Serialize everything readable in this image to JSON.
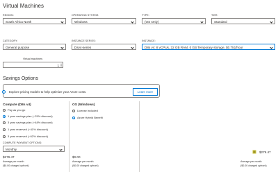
{
  "title": "Virtual Machines",
  "region": {
    "label": "REGION:",
    "value": "South Africa North"
  },
  "os": {
    "label": "OPERATING SYSTEM:",
    "value": "Windows"
  },
  "type": {
    "label": "TYPE:",
    "value": "(OS Only)"
  },
  "tier": {
    "label": "TIER:",
    "value": "Standard"
  },
  "category": {
    "label": "CATEGORY:",
    "value": "General purpose"
  },
  "series": {
    "label": "INSTANCE SERIES:",
    "value": "Dsv4-series"
  },
  "instance": {
    "label": "INSTANCE:",
    "value": "D8s v4: 8 vCPUs, 32 GB RAM, 0 GB Temporary storage, $0.751/hour"
  },
  "vm_count": {
    "label": "Virtual machines",
    "value": "1"
  },
  "savings": {
    "title": "Savings Options",
    "banner_text": "Explore pricing models to help optimize your Azure costs.",
    "learn_more": "Learn more"
  },
  "compute": {
    "title": "Compute (D8s v4)",
    "options": [
      {
        "label": "Pay as you go",
        "selected": false
      },
      {
        "label": "1 year savings plan (~25% discount)",
        "selected": true
      },
      {
        "label": "3 year savings plan (~48% discount)",
        "selected": false
      },
      {
        "label": "1 year reserved (~41% discount)",
        "selected": false
      },
      {
        "label": "3 year reserved (~62% discount)",
        "selected": false
      }
    ],
    "payment_label": "COMPUTE PAYMENT OPTIONS:",
    "payment_value": "Monthly",
    "price": "$279.47",
    "per_month": "Average per month",
    "upfront": "($0.00 charged upfront)"
  },
  "os_section": {
    "title": "OS (Windows)",
    "options": [
      {
        "label": "License included",
        "selected": false
      },
      {
        "label": "Azure Hybrid Benefit",
        "selected": true
      }
    ],
    "price": "$0.00",
    "per_month": "Average per month",
    "upfront": "($0.00 charged upfront)"
  },
  "total": {
    "price": "$279.47",
    "per_month": "Average per month",
    "upfront": "($0.00 charged upfront)"
  },
  "icons": {
    "info": "info-icon",
    "chevron": "chevron-down-icon",
    "stepper": "stepper-icon"
  },
  "colors": {
    "accent": "#0078d4",
    "border": "#8a8886",
    "text": "#323130"
  }
}
